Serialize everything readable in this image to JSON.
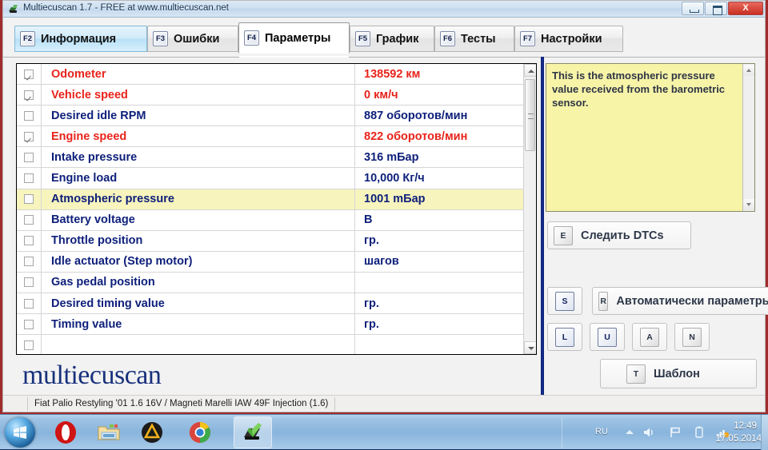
{
  "window": {
    "title": "Multiecuscan 1.7 - FREE at www.multiecuscan.net",
    "icon": "app-icon",
    "controls": {
      "minimize": "minimize",
      "maximize": "maximize",
      "close": "X"
    }
  },
  "tabs": [
    {
      "key": "F2",
      "label": "Информация",
      "state": "hovered"
    },
    {
      "key": "F3",
      "label": "Ошибки",
      "state": "normal"
    },
    {
      "key": "F4",
      "label": "Параметры",
      "state": "active"
    },
    {
      "key": "F5",
      "label": "График",
      "state": "normal"
    },
    {
      "key": "F6",
      "label": "Тесты",
      "state": "normal"
    },
    {
      "key": "F7",
      "label": "Настройки",
      "state": "normal"
    }
  ],
  "parameters": [
    {
      "checked": true,
      "name": "Odometer",
      "value": "138592 км",
      "color": "red",
      "selected": false
    },
    {
      "checked": true,
      "name": "Vehicle speed",
      "value": "0 км/ч",
      "color": "red",
      "selected": false
    },
    {
      "checked": false,
      "name": "Desired idle RPM",
      "value": "887 оборотов/мин",
      "color": "blue",
      "selected": false
    },
    {
      "checked": true,
      "name": "Engine speed",
      "value": "822 оборотов/мин",
      "color": "red",
      "selected": false
    },
    {
      "checked": false,
      "name": "Intake pressure",
      "value": "316 mБар",
      "color": "blue",
      "selected": false
    },
    {
      "checked": false,
      "name": "Engine load",
      "value": "10,000 Кг/ч",
      "color": "blue",
      "selected": false
    },
    {
      "checked": false,
      "name": "Atmospheric pressure",
      "value": "1001 mБар",
      "color": "blue",
      "selected": true
    },
    {
      "checked": false,
      "name": "Battery voltage",
      "value": "В",
      "color": "blue",
      "selected": false
    },
    {
      "checked": false,
      "name": "Throttle position",
      "value": "гр.",
      "color": "blue",
      "selected": false
    },
    {
      "checked": false,
      "name": "Idle actuator (Step motor)",
      "value": "шагов",
      "color": "blue",
      "selected": false
    },
    {
      "checked": false,
      "name": "Gas pedal position",
      "value": "",
      "color": "blue",
      "selected": false
    },
    {
      "checked": false,
      "name": "Desired timing value",
      "value": "гр.",
      "color": "blue",
      "selected": false
    },
    {
      "checked": false,
      "name": "Timing value",
      "value": "гр.",
      "color": "blue",
      "selected": false
    },
    {
      "checked": false,
      "name": "",
      "value": "",
      "color": "blue",
      "selected": false
    }
  ],
  "help": {
    "text": "This is the atmospheric pressure value received from the barometric sensor."
  },
  "buttons": {
    "dtc": {
      "key": "E",
      "label": "Следить DTCs"
    },
    "auto": {
      "key": "R",
      "label": "Автоматически параметры"
    },
    "start": {
      "key": "S",
      "label": ""
    },
    "load": {
      "key": "L",
      "label": ""
    },
    "unload": {
      "key": "U",
      "label": ""
    },
    "all": {
      "key": "A",
      "label": ""
    },
    "none": {
      "key": "N",
      "label": ""
    },
    "template": {
      "key": "T",
      "label": "Шаблон"
    }
  },
  "branding": {
    "logo": "multiecuscan"
  },
  "statusbar": {
    "vehicle": "Fiat Palio Restyling '01 1.6 16V / Magneti Marelli IAW 49F Injection (1.6)"
  },
  "taskbar": {
    "start": "start-orb",
    "items": [
      {
        "icon": "opera-icon",
        "name": "opera"
      },
      {
        "icon": "explorer-icon",
        "name": "windows-explorer"
      },
      {
        "icon": "amd-icon",
        "name": "auslogics"
      },
      {
        "icon": "chrome-icon",
        "name": "google-chrome"
      },
      {
        "icon": "multiecuscan-icon",
        "name": "multiecuscan"
      }
    ],
    "tray": {
      "language": "RU",
      "icons": [
        "volume-icon",
        "network-flag-icon",
        "battery-icon",
        "signal-icon"
      ],
      "time": "12:49",
      "date": "17.05.2014"
    }
  },
  "colors": {
    "red_value": "#e8231a",
    "blue_value": "#0d1f7a",
    "selected_row": "#f7f4bd",
    "help_bg": "#f7f4a8",
    "divider": "#16309a"
  }
}
